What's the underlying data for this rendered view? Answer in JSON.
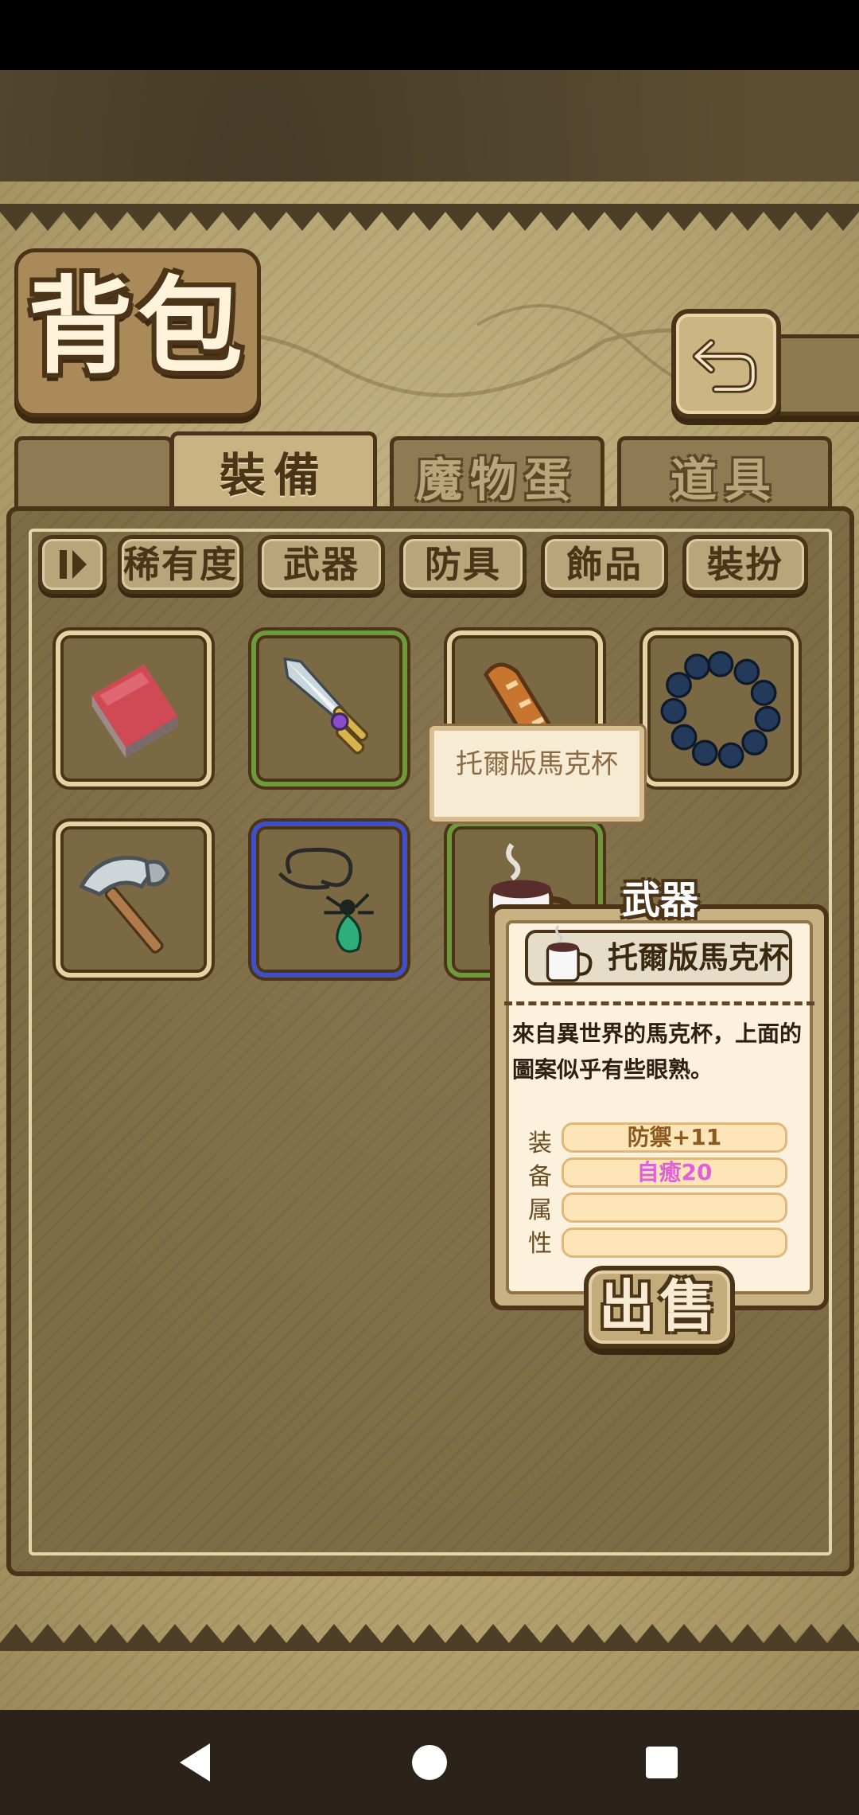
{
  "title": "背包",
  "tabs": [
    {
      "label": "裝備",
      "active": true
    },
    {
      "label": "魔物蛋",
      "active": false
    },
    {
      "label": "道具",
      "active": false
    }
  ],
  "filters": {
    "sort_icon": "sort-toggle-icon",
    "items": [
      "稀有度",
      "武器",
      "防具",
      "飾品",
      "裝扮"
    ]
  },
  "inventory": {
    "items": [
      {
        "icon": "red-brick-icon",
        "rarity": "common"
      },
      {
        "icon": "sword-icon",
        "rarity": "uncommon"
      },
      {
        "icon": "bread-icon",
        "rarity": "common"
      },
      {
        "icon": "stone-bracelet-icon",
        "rarity": "common"
      },
      {
        "icon": "hammer-icon",
        "rarity": "common"
      },
      {
        "icon": "spider-necklace-icon",
        "rarity": "rare"
      },
      {
        "icon": "mug-icon",
        "rarity": "uncommon"
      }
    ]
  },
  "tooltip": {
    "text": "托爾版馬克杯"
  },
  "detail": {
    "category": "武器",
    "name": "托爾版馬克杯",
    "icon": "mug-icon",
    "description_line1": "來自異世界的馬克杯，上面的",
    "description_line2": "圖案似乎有些眼熟。",
    "attr_label": [
      "装",
      "备",
      "属",
      "性"
    ],
    "stats": [
      "防禦+11",
      "自癒20",
      "",
      ""
    ],
    "stat_colors": [
      "#8a5a1e",
      "#e060d8"
    ],
    "sell_label": "出售"
  },
  "nav": {
    "back": "nav-back-icon",
    "home": "nav-home-icon",
    "recents": "nav-recents-icon"
  },
  "colors": {
    "rarity_common": "#e6d3a3",
    "rarity_uncommon": "#6f9a3c",
    "rarity_rare": "#3f4fc8"
  }
}
